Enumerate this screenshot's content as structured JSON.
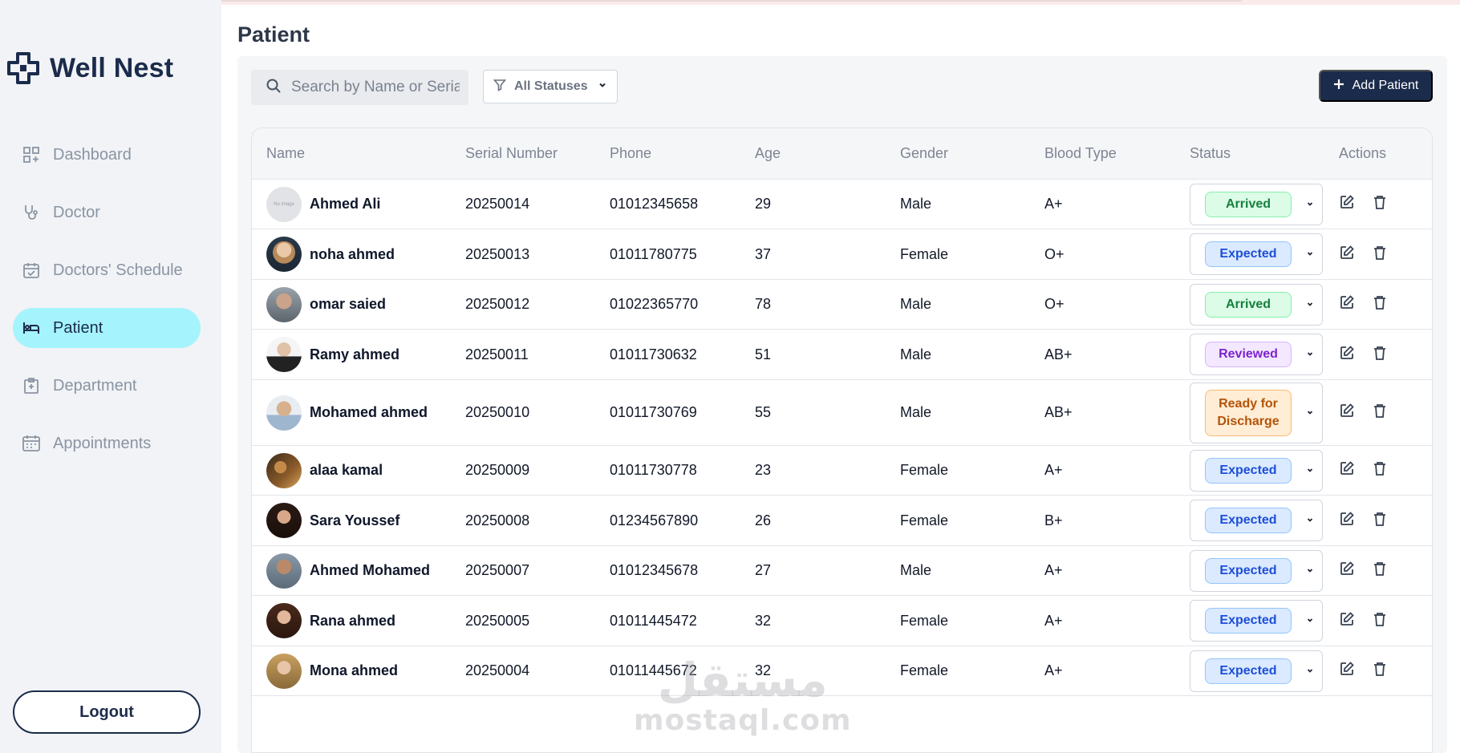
{
  "app": {
    "name": "Well Nest"
  },
  "sidebar": {
    "items": [
      {
        "label": "Dashboard",
        "icon": "dashboard-icon",
        "active": false
      },
      {
        "label": "Doctor",
        "icon": "stethoscope-icon",
        "active": false
      },
      {
        "label": "Doctors' Schedule",
        "icon": "calendar-check-icon",
        "active": false
      },
      {
        "label": "Patient",
        "icon": "bed-icon",
        "active": true
      },
      {
        "label": "Department",
        "icon": "building-icon",
        "active": false
      },
      {
        "label": "Appointments",
        "icon": "calendar-icon",
        "active": false
      }
    ],
    "logout_label": "Logout"
  },
  "page": {
    "title": "Patient"
  },
  "toolbar": {
    "search_placeholder": "Search by Name or Serial",
    "status_filter": "All Statuses",
    "add_label": "Add Patient"
  },
  "table": {
    "headers": [
      "Name",
      "Serial Number",
      "Phone",
      "Age",
      "Gender",
      "Blood Type",
      "Status",
      "Actions"
    ],
    "rows": [
      {
        "name": "Ahmed Ali",
        "serial": "20250014",
        "phone": "01012345658",
        "age": "29",
        "gender": "Male",
        "blood": "A+",
        "status": "Arrived",
        "avatar": "No image"
      },
      {
        "name": "noha ahmed",
        "serial": "20250013",
        "phone": "01011780775",
        "age": "37",
        "gender": "Female",
        "blood": "O+",
        "status": "Expected"
      },
      {
        "name": "omar saied",
        "serial": "20250012",
        "phone": "01022365770",
        "age": "78",
        "gender": "Male",
        "blood": "O+",
        "status": "Arrived"
      },
      {
        "name": "Ramy ahmed",
        "serial": "20250011",
        "phone": "01011730632",
        "age": "51",
        "gender": "Male",
        "blood": "AB+",
        "status": "Reviewed"
      },
      {
        "name": "Mohamed ahmed",
        "serial": "20250010",
        "phone": "01011730769",
        "age": "55",
        "gender": "Male",
        "blood": "AB+",
        "status": "Ready for Discharge"
      },
      {
        "name": "alaa kamal",
        "serial": "20250009",
        "phone": "01011730778",
        "age": "23",
        "gender": "Female",
        "blood": "A+",
        "status": "Expected"
      },
      {
        "name": "Sara Youssef",
        "serial": "20250008",
        "phone": "01234567890",
        "age": "26",
        "gender": "Female",
        "blood": "B+",
        "status": "Expected"
      },
      {
        "name": "Ahmed Mohamed",
        "serial": "20250007",
        "phone": "01012345678",
        "age": "27",
        "gender": "Male",
        "blood": "A+",
        "status": "Expected"
      },
      {
        "name": "Rana ahmed",
        "serial": "20250005",
        "phone": "01011445472",
        "age": "32",
        "gender": "Female",
        "blood": "A+",
        "status": "Expected"
      },
      {
        "name": "Mona ahmed",
        "serial": "20250004",
        "phone": "01011445672",
        "age": "32",
        "gender": "Female",
        "blood": "A+",
        "status": "Expected"
      }
    ]
  },
  "watermark": {
    "arabic": "مستقل",
    "latin": "mostaql.com"
  },
  "colors": {
    "brand": "#1b2b4b",
    "active_nav": "#a5f3fc",
    "arrived": "#15803d",
    "expected": "#1d4ed8",
    "reviewed": "#7e22ce",
    "ready": "#b45309"
  }
}
